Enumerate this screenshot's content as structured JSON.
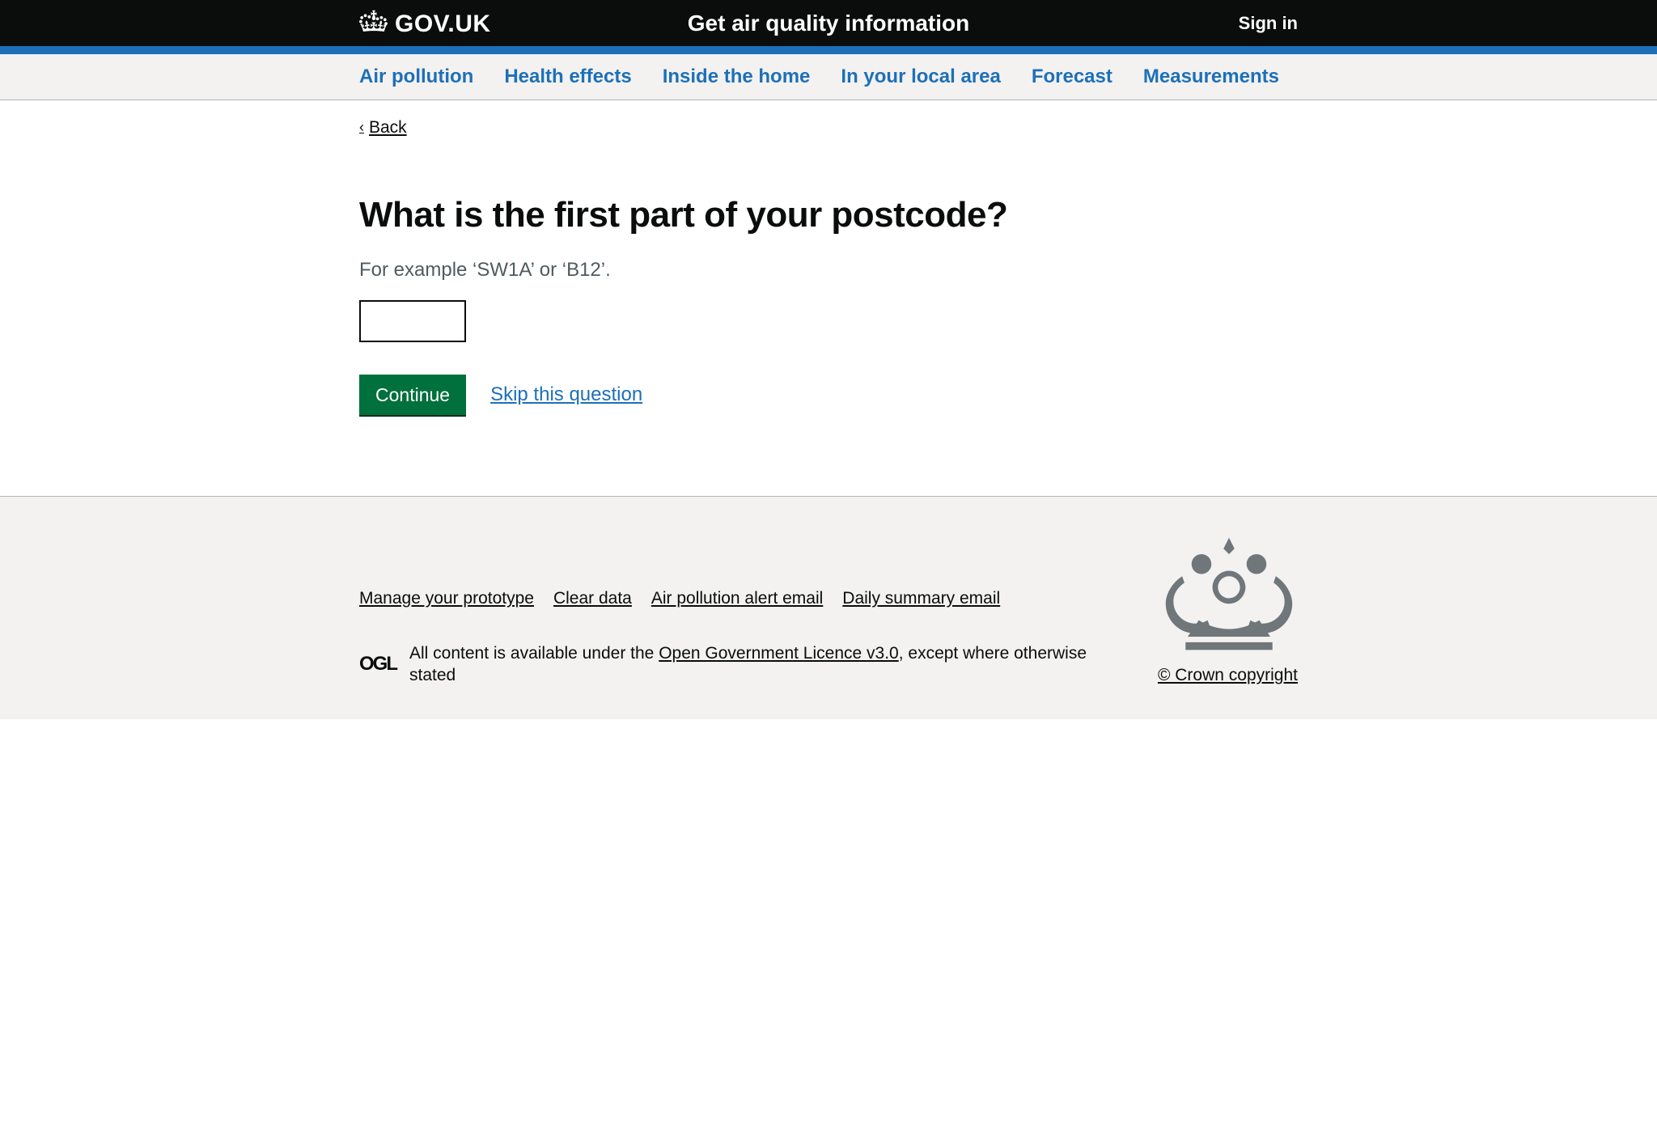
{
  "header": {
    "logotype": "GOV.UK",
    "service_name": "Get air quality information",
    "signin": "Sign in"
  },
  "nav": {
    "items": [
      {
        "label": "Air pollution"
      },
      {
        "label": "Health effects"
      },
      {
        "label": "Inside the home"
      },
      {
        "label": "In your local area"
      },
      {
        "label": "Forecast"
      },
      {
        "label": "Measurements"
      }
    ]
  },
  "back_link": "Back",
  "main": {
    "heading": "What is the first part of your postcode?",
    "hint": "For example ‘SW1A’ or ‘B12’.",
    "input_value": "",
    "continue": "Continue",
    "skip": "Skip this question"
  },
  "footer": {
    "links": [
      {
        "label": "Manage your prototype"
      },
      {
        "label": "Clear data"
      },
      {
        "label": "Air pollution alert email"
      },
      {
        "label": "Daily summary email"
      }
    ],
    "licence_prefix": "All content is available under the ",
    "licence_link": "Open Government Licence v3.0",
    "licence_suffix": ", except where otherwise stated",
    "ogl": "OGL",
    "copyright": "© Crown copyright"
  }
}
